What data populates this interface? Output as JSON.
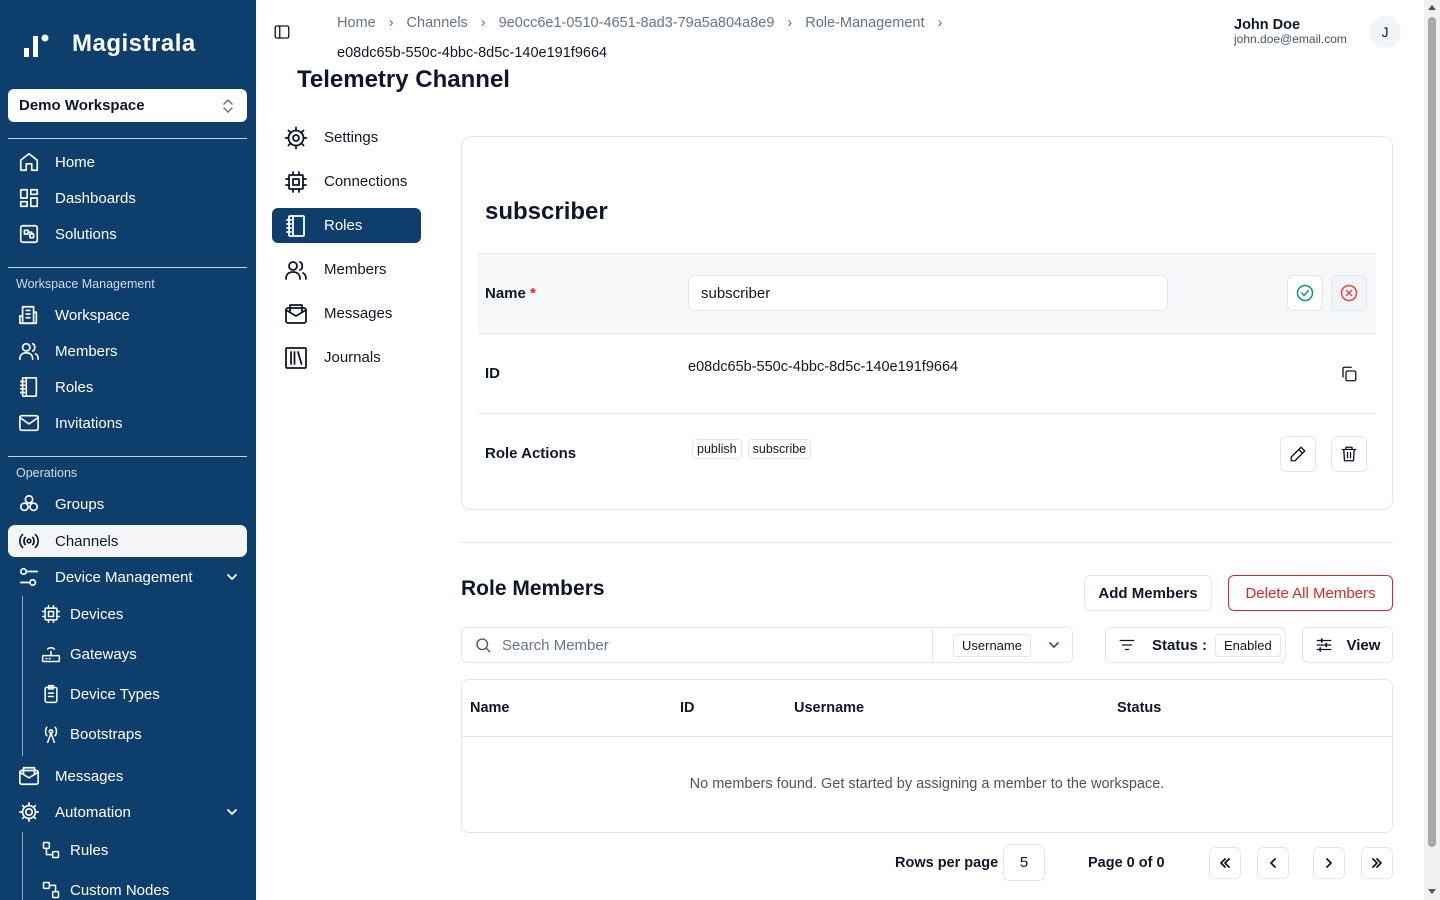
{
  "app": {
    "logo_text": "Magistrala"
  },
  "workspace_selector": {
    "value": "Demo Workspace"
  },
  "sidebar": {
    "top_items": [
      {
        "label": "Home",
        "icon": "home-icon"
      },
      {
        "label": "Dashboards",
        "icon": "dashboard-icon"
      },
      {
        "label": "Solutions",
        "icon": "solutions-icon"
      }
    ],
    "workspace_section": {
      "title": "Workspace Management",
      "items": [
        {
          "label": "Workspace",
          "icon": "building-icon"
        },
        {
          "label": "Members",
          "icon": "users-icon"
        },
        {
          "label": "Roles",
          "icon": "book-icon"
        },
        {
          "label": "Invitations",
          "icon": "mail-icon"
        }
      ]
    },
    "operations_section": {
      "title": "Operations",
      "items": [
        {
          "label": "Groups",
          "icon": "groups-icon"
        },
        {
          "label": "Channels",
          "icon": "broadcast-icon",
          "active": true
        },
        {
          "label": "Device Management",
          "icon": "sliders-icon"
        }
      ],
      "device_sub_items": [
        {
          "label": "Devices",
          "icon": "cpu-icon"
        },
        {
          "label": "Gateways",
          "icon": "router-icon"
        },
        {
          "label": "Device Types",
          "icon": "clipboard-icon"
        },
        {
          "label": "Bootstraps",
          "icon": "antenna-icon"
        }
      ],
      "more_items": [
        {
          "label": "Messages",
          "icon": "mail-open-icon"
        },
        {
          "label": "Automation",
          "icon": "gear-icon"
        }
      ],
      "automation_sub_items": [
        {
          "label": "Rules",
          "icon": "workflow-icon"
        },
        {
          "label": "Custom Nodes",
          "icon": "nodes-icon"
        }
      ]
    }
  },
  "breadcrumb": {
    "items": [
      "Home",
      "Channels",
      "9e0cc6e1-0510-4651-8ad3-79a5a804a8e9",
      "Role-Management"
    ],
    "current": "e08dc65b-550c-4bbc-8d5c-140e191f9664"
  },
  "user": {
    "name": "John Doe",
    "email": "john.doe@email.com",
    "initial": "J"
  },
  "page_title": "Telemetry Channel",
  "channel_nav": [
    {
      "label": "Settings",
      "icon": "settings-icon"
    },
    {
      "label": "Connections",
      "icon": "cpu-icon"
    },
    {
      "label": "Roles",
      "icon": "book-icon",
      "active": true
    },
    {
      "label": "Members",
      "icon": "users-icon"
    },
    {
      "label": "Messages",
      "icon": "mail-open-icon"
    },
    {
      "label": "Journals",
      "icon": "library-icon"
    }
  ],
  "role": {
    "title": "subscriber",
    "name_label": "Name",
    "required_mark": "*",
    "name_value": "subscriber",
    "id_label": "ID",
    "id_value": "e08dc65b-550c-4bbc-8d5c-140e191f9664",
    "actions_label": "Role Actions",
    "actions": [
      "publish",
      "subscribe"
    ]
  },
  "members": {
    "title": "Role Members",
    "add_button": "Add Members",
    "delete_all_button": "Delete All Members",
    "search_placeholder": "Search Member",
    "search_by": "Username",
    "status_label": "Status :",
    "status_value": "Enabled",
    "view_button": "View",
    "columns": [
      "Name",
      "ID",
      "Username",
      "Status"
    ],
    "empty_message": "No members found. Get started by assigning a member to the workspace."
  },
  "pagination": {
    "rows_per_page_label": "Rows per page",
    "rows_per_page": "5",
    "page_info": "Page 0 of 0"
  },
  "colors": {
    "sidebar_bg": "#0e3e6b",
    "danger": "#dc2626",
    "success": "#0d9488"
  }
}
